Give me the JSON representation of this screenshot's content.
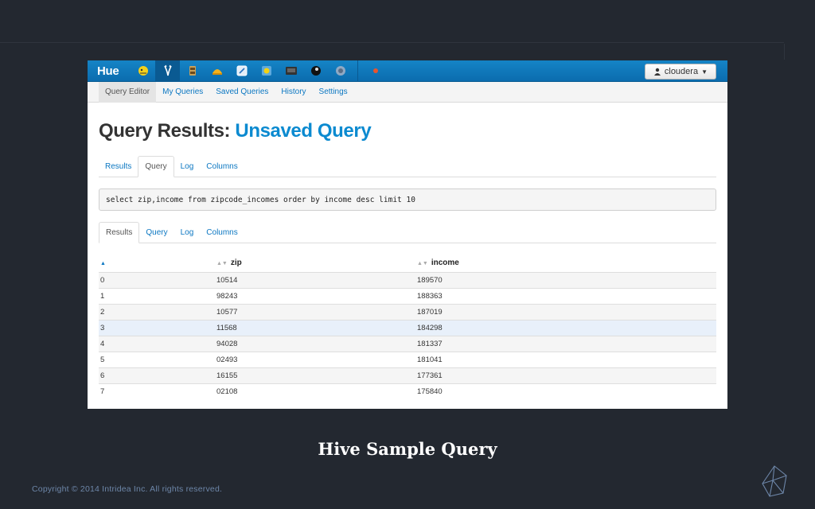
{
  "app": {
    "brand": "Hue",
    "user_label": "cloudera",
    "icons": [
      "beeswax-icon",
      "impala-icon",
      "pig-icon",
      "hive-icon",
      "jobdesigner-icon",
      "oozie-icon",
      "filebrowser-icon",
      "shell-icon",
      "useradmin-icon",
      "help-icon",
      "alert-icon"
    ]
  },
  "subnav": {
    "items": [
      "Query Editor",
      "My Queries",
      "Saved Queries",
      "History",
      "Settings"
    ],
    "active": "Query Editor"
  },
  "page": {
    "title_prefix": "Query Results: ",
    "title_accent": "Unsaved Query"
  },
  "top_tabs": [
    "Results",
    "Query",
    "Log",
    "Columns"
  ],
  "query_text": "select zip,income from zipcode_incomes order by income desc limit 10",
  "bottom_tabs": [
    "Results",
    "Query",
    "Log",
    "Columns"
  ],
  "table": {
    "columns": [
      "",
      "zip",
      "income"
    ],
    "rows": [
      [
        "0",
        "10514",
        "189570"
      ],
      [
        "1",
        "98243",
        "188363"
      ],
      [
        "2",
        "10577",
        "187019"
      ],
      [
        "3",
        "11568",
        "184298"
      ],
      [
        "4",
        "94028",
        "181337"
      ],
      [
        "5",
        "02493",
        "181041"
      ],
      [
        "6",
        "16155",
        "177361"
      ],
      [
        "7",
        "02108",
        "175840"
      ]
    ]
  },
  "slide": {
    "caption": "Hive Sample Query",
    "copyright": "Copyright © 2014 Intridea Inc. All rights reserved."
  }
}
